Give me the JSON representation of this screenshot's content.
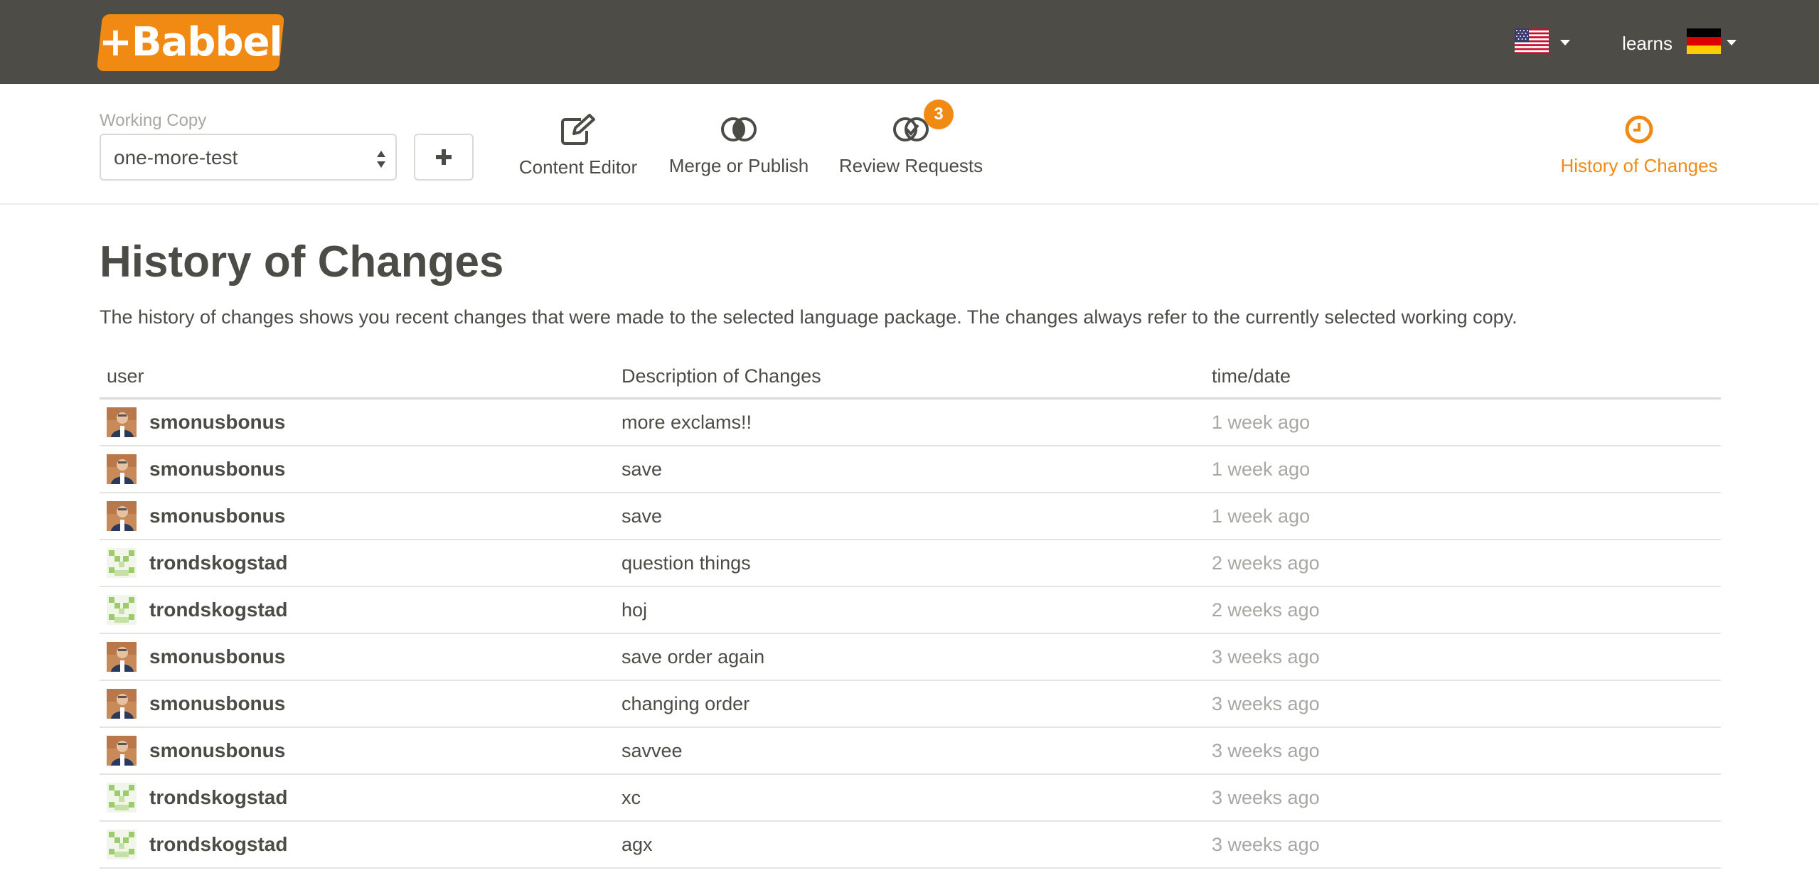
{
  "app": {
    "logo_text": "+Babbel",
    "brand_color": "#f18a12",
    "topbar_color": "#4d4c47"
  },
  "language": {
    "source_flag": "us-flag-icon",
    "learns_label": "learns",
    "target_flag": "de-flag-icon"
  },
  "working_copy": {
    "label": "Working Copy",
    "selected": "one-more-test",
    "add_icon": "plus-icon"
  },
  "nav": {
    "content_editor": "Content Editor",
    "merge_publish": "Merge or Publish",
    "review_requests": "Review Requests",
    "review_badge": "3",
    "history": "History of Changes"
  },
  "page": {
    "title": "History of Changes",
    "description": "The history of changes shows you recent changes that were made to the selected language package. The changes always refer to the currently selected working copy."
  },
  "table": {
    "headers": {
      "user": "user",
      "description": "Description of Changes",
      "time": "time/date"
    },
    "rows": [
      {
        "user": "smonusbonus",
        "avatar": "photo",
        "description": "more exclams!!",
        "time": "1 week ago"
      },
      {
        "user": "smonusbonus",
        "avatar": "photo",
        "description": "save",
        "time": "1 week ago"
      },
      {
        "user": "smonusbonus",
        "avatar": "photo",
        "description": "save",
        "time": "1 week ago"
      },
      {
        "user": "trondskogstad",
        "avatar": "identicon",
        "description": "question things",
        "time": "2 weeks ago"
      },
      {
        "user": "trondskogstad",
        "avatar": "identicon",
        "description": "hoj",
        "time": "2 weeks ago"
      },
      {
        "user": "smonusbonus",
        "avatar": "photo",
        "description": "save order again",
        "time": "3 weeks ago"
      },
      {
        "user": "smonusbonus",
        "avatar": "photo",
        "description": "changing order",
        "time": "3 weeks ago"
      },
      {
        "user": "smonusbonus",
        "avatar": "photo",
        "description": "savvee",
        "time": "3 weeks ago"
      },
      {
        "user": "trondskogstad",
        "avatar": "identicon",
        "description": "xc",
        "time": "3 weeks ago"
      },
      {
        "user": "trondskogstad",
        "avatar": "identicon",
        "description": "agx",
        "time": "3 weeks ago"
      }
    ]
  }
}
